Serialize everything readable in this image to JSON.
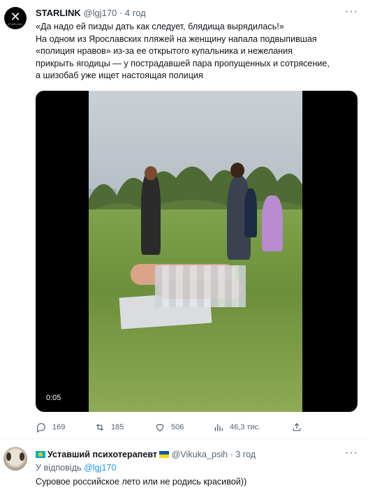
{
  "tweet": {
    "author_name": "STARLINK",
    "author_handle": "@lgj170",
    "time": "4 год",
    "avatar_text": "STARLINK",
    "lines": [
      "«Да надо ей пизды дать как следует, блядища вырядилась!»",
      "На одном из Ярославских пляжей на женщину напала подвыпившая",
      "«полиция нравов» из-за ее открытого купальника и нежелания",
      "прикрыть ягодицы — у пострадавшей пара пропущенных и сотрясение,",
      "а шизобаб уже ищет настоящая полиция"
    ],
    "video_time": "0:05",
    "replies": "169",
    "retweets": "185",
    "likes": "506",
    "views": "46,3 тис."
  },
  "reply": {
    "author_name": "Уставший психотерапевт",
    "author_handle": "@Vikuka_psih",
    "time": "3 год",
    "replying_label": "У відповідь",
    "replying_handle": "@lgj170",
    "text": "Суровое российское лето или не родись красивой))"
  },
  "icons": {
    "reply": "reply-icon",
    "retweet": "retweet-icon",
    "like": "heart-icon",
    "views": "views-icon",
    "share": "share-icon",
    "more": "more-icon"
  },
  "colors": {
    "accent": "#1d9bf0",
    "secondary_text": "#536471"
  }
}
